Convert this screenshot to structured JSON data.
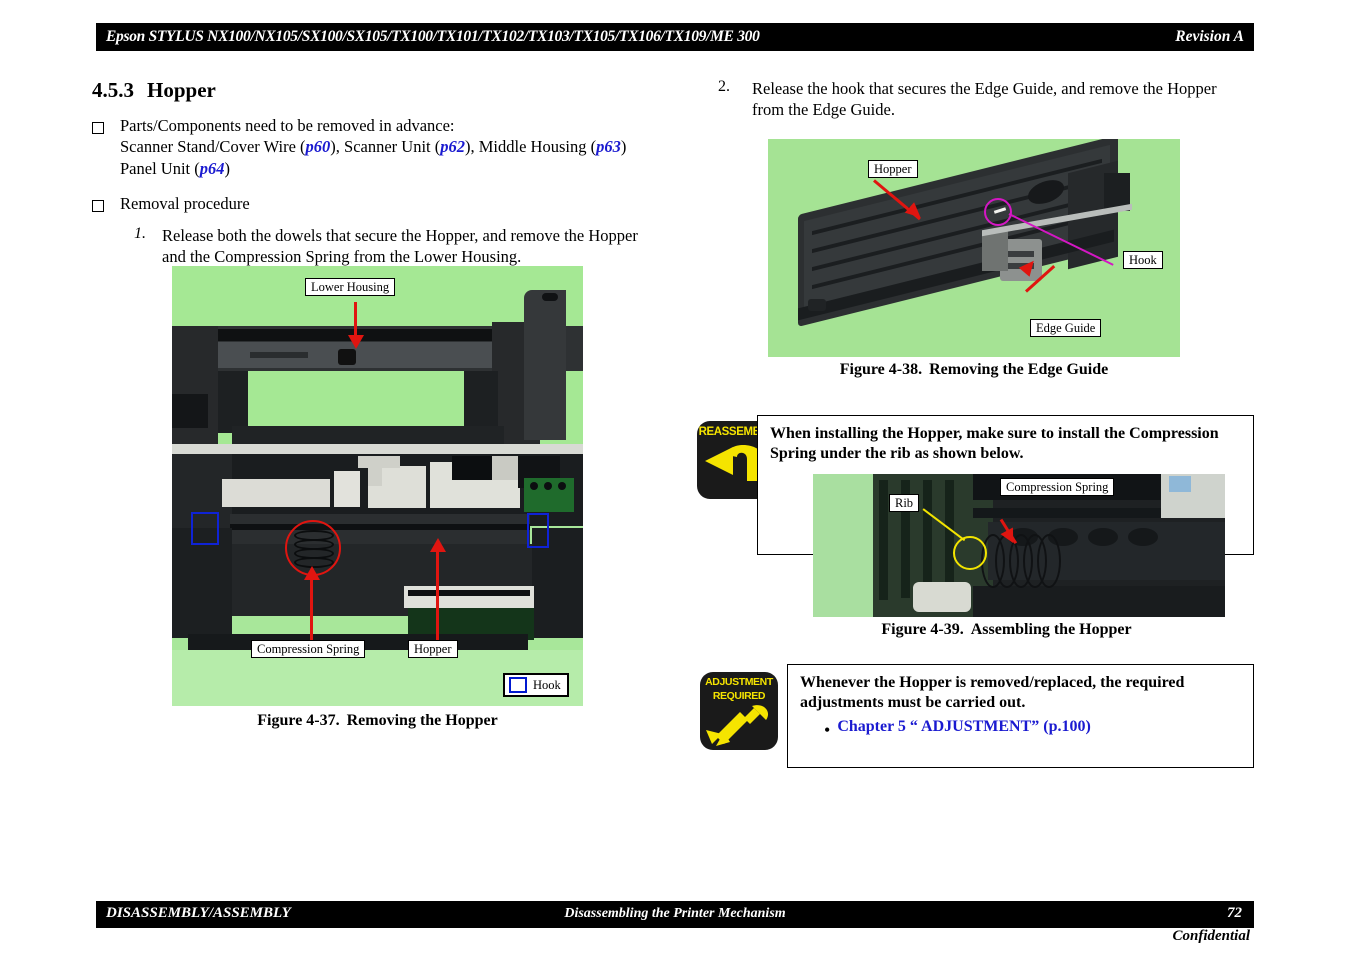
{
  "header": {
    "title": "Epson STYLUS NX100/NX105/SX100/SX105/TX100/TX101/TX102/TX103/TX105/TX106/TX109/ME 300",
    "revision": "Revision A"
  },
  "footer": {
    "left": "DISASSEMBLY/ASSEMBLY",
    "center": "Disassembling the Printer Mechanism",
    "page": "72",
    "confidential": "Confidential"
  },
  "section": {
    "number": "4.5.3",
    "title": "Hopper"
  },
  "left_column": {
    "prereq_lead": "Parts/Components need to be removed in advance:",
    "prereq_line1_a": "Scanner Stand/Cover Wire (",
    "prereq_link1": "p60",
    "prereq_line1_b": "), Scanner Unit (",
    "prereq_link2": "p62",
    "prereq_line1_c": "), Middle Housing (",
    "prereq_link3": "p63",
    "prereq_line1_d": ")",
    "prereq_line2_a": "Panel Unit (",
    "prereq_link4": "p64",
    "prereq_line2_b": ")",
    "removal_heading": "Removal procedure",
    "step1_num": "1.",
    "step1_text": "Release both the dowels that secure the Hopper, and remove the Hopper and the Compression Spring from the Lower Housing.",
    "figure37": {
      "caption_label": "Figure 4-37.",
      "caption_text": "Removing the Hopper",
      "labels": {
        "lower_housing": "Lower Housing",
        "compression_spring": "Compression Spring",
        "hopper": "Hopper",
        "hook_legend": "Hook"
      }
    }
  },
  "right_column": {
    "step2_num": "2.",
    "step2_text": "Release the hook that secures the Edge Guide, and remove the Hopper from the Edge Guide.",
    "figure38": {
      "caption_label": "Figure 4-38.",
      "caption_text": "Removing the Edge Guide",
      "labels": {
        "hopper": "Hopper",
        "hook": "Hook",
        "edge_guide": "Edge Guide"
      }
    },
    "reassembly_notice": {
      "badge_label": "REASSEMBLY",
      "badge_icon": "u-turn-arrow-icon",
      "text": "When installing the Hopper, make sure to install the Compression Spring under the rib as shown below."
    },
    "figure39": {
      "caption_label": "Figure 4-39.",
      "caption_text": "Assembling the Hopper",
      "labels": {
        "rib": "Rib",
        "compression_spring": "Compression Spring"
      }
    },
    "adjustment_notice": {
      "badge_label_line1": "ADJUSTMENT",
      "badge_label_line2": "REQUIRED",
      "badge_icon": "wrench-icon",
      "text": "Whenever the Hopper is removed/replaced, the required adjustments must be carried out.",
      "link": "Chapter 5 “ ADJUSTMENT” (p.100)"
    }
  },
  "colors": {
    "link_blue": "#1a1ad0",
    "hook_blue": "#0f23d6",
    "arrow_red": "#e01510",
    "circle_magenta": "#d417c4",
    "circle_yellow": "#f2e400",
    "badge_black": "#1a1a1a",
    "badge_yellow": "#f5e400",
    "photo_green": "#a8e79a"
  }
}
